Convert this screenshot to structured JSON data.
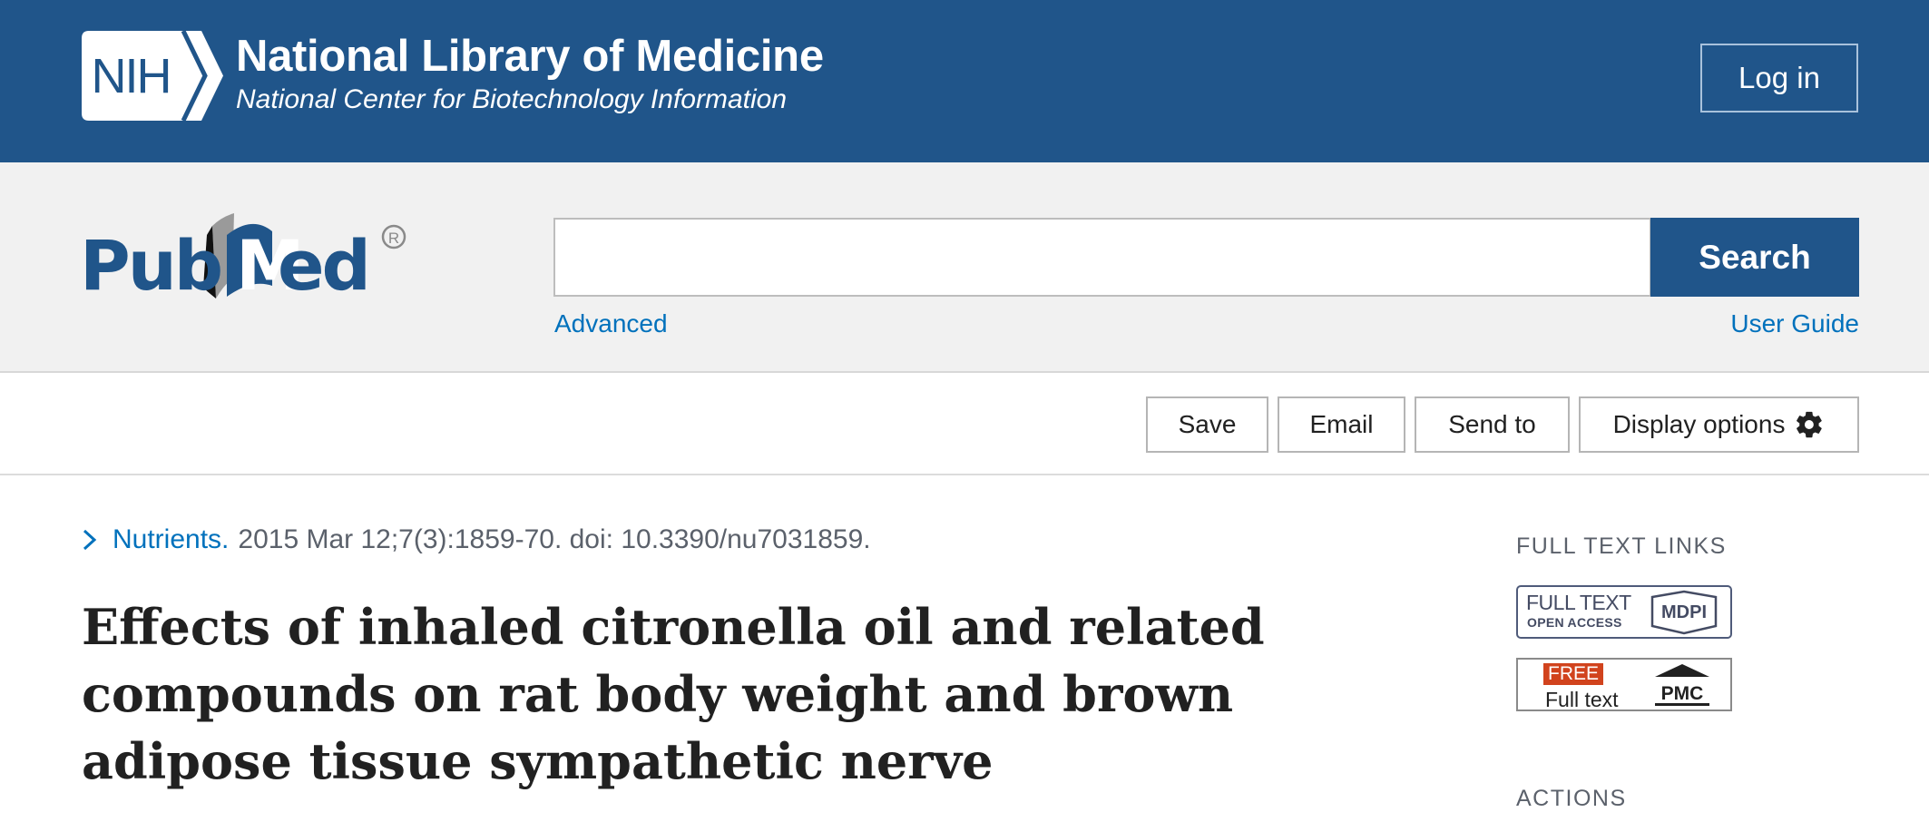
{
  "nih_header": {
    "logo_text": "NIH",
    "title": "National Library of Medicine",
    "subtitle": "National Center for Biotechnology Information",
    "login_label": "Log in",
    "background_color": "#20558a"
  },
  "search": {
    "logo_text": "PubMed",
    "input_value": "",
    "button_label": "Search",
    "advanced_link": "Advanced",
    "user_guide_link": "User Guide"
  },
  "toolbar": {
    "save_label": "Save",
    "email_label": "Email",
    "send_to_label": "Send to",
    "display_options_label": "Display options",
    "display_options_icon": "gear-icon"
  },
  "article": {
    "journal": "Nutrients.",
    "citation": "2015 Mar 12;7(3):1859-70. doi: 10.3390/nu7031859.",
    "title": "Effects of inhaled citronella oil and related compounds on rat body weight and brown adipose tissue sympathetic nerve"
  },
  "sidebar": {
    "full_text_links_heading": "FULL TEXT LINKS",
    "mdpi_badge": {
      "line1": "FULL TEXT",
      "line2": "OPEN ACCESS",
      "brand": "MDPI"
    },
    "pmc_badge": {
      "free": "FREE",
      "full_text": "Full text",
      "brand": "PMC"
    },
    "actions_heading": "ACTIONS"
  },
  "colors": {
    "brand_blue": "#20558a",
    "link_blue": "#0071bc",
    "free_badge_red": "#d1431d"
  }
}
